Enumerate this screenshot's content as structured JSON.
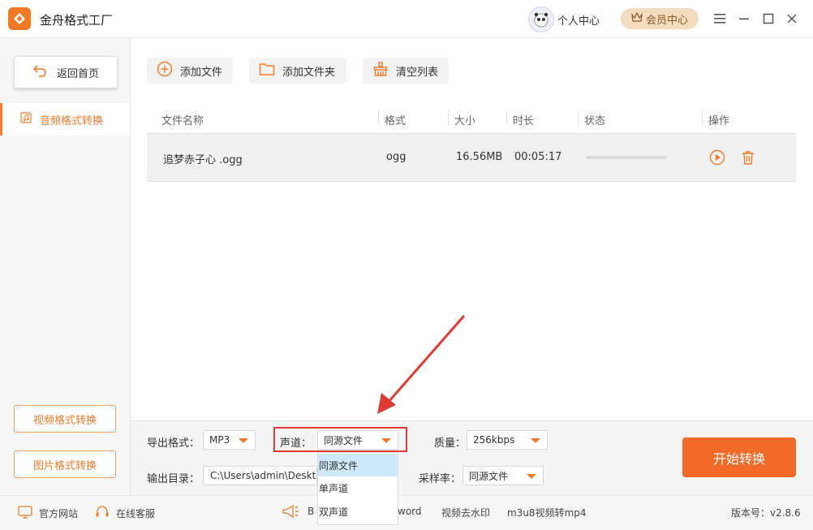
{
  "app": {
    "title": "金舟格式工厂"
  },
  "header": {
    "user_center": "个人中心",
    "member_center": "会员中心"
  },
  "sidebar": {
    "back_home": "返回首页",
    "active_item": "音频格式转换",
    "video_convert": "视频格式转换",
    "image_convert": "图片格式转换"
  },
  "toolbar": {
    "add_file": "添加文件",
    "add_folder": "添加文件夹",
    "clear_list": "清空列表"
  },
  "table": {
    "headers": [
      "文件名称",
      "格式",
      "大小",
      "时长",
      "状态",
      "操作"
    ],
    "rows": [
      {
        "name": "追梦赤子心 .ogg",
        "format": "ogg",
        "size": "16.56MB",
        "duration": "00:05:17",
        "progress": 0
      }
    ]
  },
  "settings": {
    "export_format_label": "导出格式：",
    "export_format_value": "MP3",
    "channel_label": "声道：",
    "channel_value": "同源文件",
    "quality_label": "质量：",
    "quality_value": "256kbps",
    "output_dir_label": "输出目录：",
    "output_dir_value": "C:\\Users\\admin\\Deskto",
    "sample_rate_label": "采样率：",
    "sample_rate_value": "同源文件",
    "start_button": "开始转换",
    "channel_options": [
      "同源文件",
      "单声道",
      "双声道"
    ],
    "channel_selected_index": 0
  },
  "statusbar": {
    "official_site": "官方网站",
    "online_service": "在线客服",
    "promo_1_left": "B",
    "promo_1_right": "word",
    "promo_2": "视频去水印",
    "promo_3": "m3u8视频转mp4",
    "version": "版本号：v2.8.6"
  },
  "colors": {
    "accent": "#f47a2b",
    "start_button": "#f26a27",
    "highlight_box": "#e03a34",
    "selected_option_bg": "#cde8fb"
  }
}
